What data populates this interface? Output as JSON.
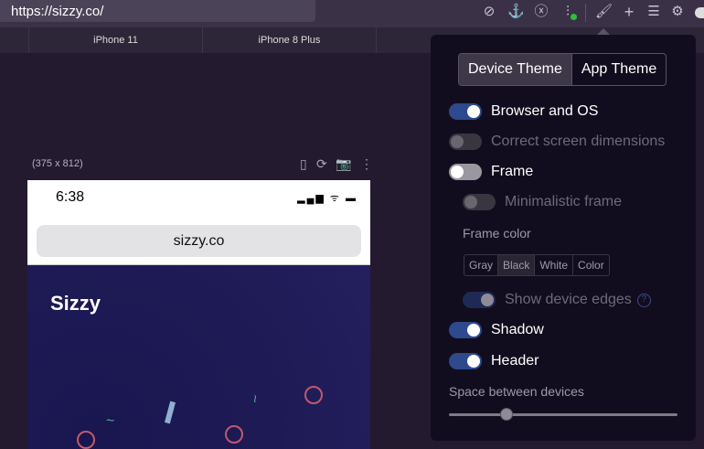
{
  "toolbar": {
    "url": "https://sizzy.co/",
    "icons": [
      "compass-icon",
      "anchor-icon",
      "close-circle-icon",
      "sliders-icon",
      "brush-icon",
      "plus-icon",
      "list-icon",
      "gear-icon"
    ]
  },
  "device_tabs": [
    "iPhone 11",
    "iPhone 8 Plus"
  ],
  "device": {
    "dimensions": "(375 x 812)",
    "time": "6:38",
    "address": "sizzy.co",
    "brand": "Sizzy"
  },
  "panel": {
    "themes": [
      "Device Theme",
      "App Theme"
    ],
    "toggles": [
      {
        "label": "Browser and OS",
        "state": "on"
      },
      {
        "label": "Correct screen dimensions",
        "state": "disabled"
      },
      {
        "label": "Frame",
        "state": "off"
      },
      {
        "label": "Minimalistic frame",
        "state": "disabled"
      }
    ],
    "frame_color_label": "Frame color",
    "frame_colors": [
      "Gray",
      "Black",
      "White",
      "Color"
    ],
    "show_edges": "Show device edges",
    "help": "?",
    "shadow": "Shadow",
    "header": "Header",
    "space_label": "Space between devices",
    "space_value": 0.25
  }
}
